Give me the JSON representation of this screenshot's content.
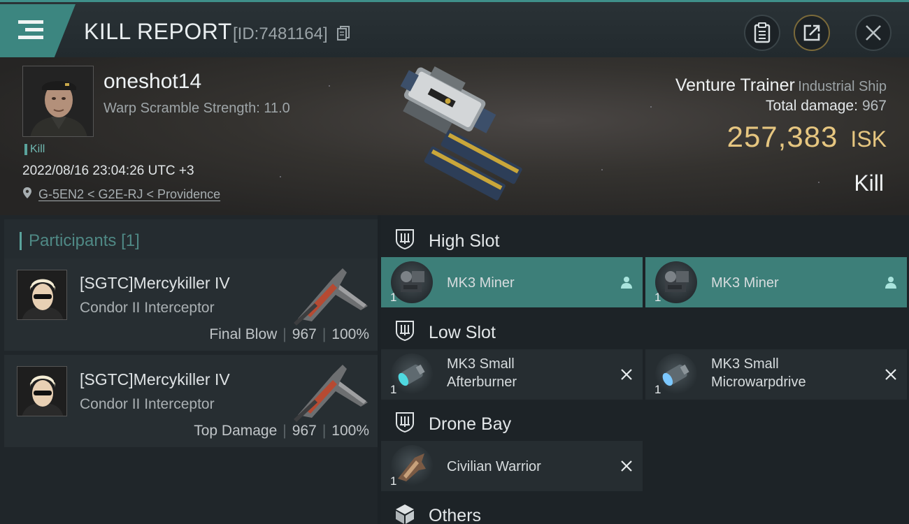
{
  "header": {
    "title": "KILL REPORT",
    "report_id": "[ID:7481164]",
    "icons": {
      "menu": "hamburger-menu-icon",
      "copy": "copy-icon",
      "clipboard": "clipboard-icon",
      "share": "share-icon",
      "close": "close-icon"
    }
  },
  "victim": {
    "name": "oneshot14",
    "subtitle": "Warp Scramble Strength: 11.0",
    "tag": "Kill",
    "timestamp": "2022/08/16 23:04:26 UTC +3",
    "location": "G-5EN2 < G2E-RJ < Providence",
    "ship_name": "Venture Trainer",
    "ship_class": "Industrial Ship",
    "total_damage_label": "Total damage:",
    "total_damage": "967",
    "isk_value": "257,383",
    "isk_unit": "ISK",
    "result": "Kill"
  },
  "participants": {
    "title": "Participants",
    "count": "[1]",
    "items": [
      {
        "name": "[SGTC]Mercykiller IV",
        "ship": "Condor II Interceptor",
        "role": "Final Blow",
        "damage": "967",
        "percent": "100%"
      },
      {
        "name": "[SGTC]Mercykiller IV",
        "ship": "Condor II Interceptor",
        "role": "Top Damage",
        "damage": "967",
        "percent": "100%"
      }
    ]
  },
  "slots": {
    "high": {
      "title": "High Slot",
      "items": [
        {
          "name": "MK3 Miner",
          "qty": "1",
          "action_icon": "person-icon"
        },
        {
          "name": "MK3 Miner",
          "qty": "1",
          "action_icon": "person-icon"
        }
      ]
    },
    "low": {
      "title": "Low Slot",
      "items": [
        {
          "name_line1": "MK3 Small",
          "name_line2": "Afterburner",
          "qty": "1",
          "action_icon": "destroyed-x-icon"
        },
        {
          "name_line1": "MK3 Small",
          "name_line2": "Microwarpdrive",
          "qty": "1",
          "action_icon": "destroyed-x-icon"
        }
      ]
    },
    "drone": {
      "title": "Drone Bay",
      "items": [
        {
          "name": "Civilian Warrior",
          "qty": "1",
          "action_icon": "destroyed-x-icon"
        }
      ]
    },
    "others": {
      "title": "Others"
    }
  },
  "colors": {
    "accent_teal": "#3c8680",
    "isk_gold": "#e6c680",
    "active_item": "#3d7f79"
  }
}
